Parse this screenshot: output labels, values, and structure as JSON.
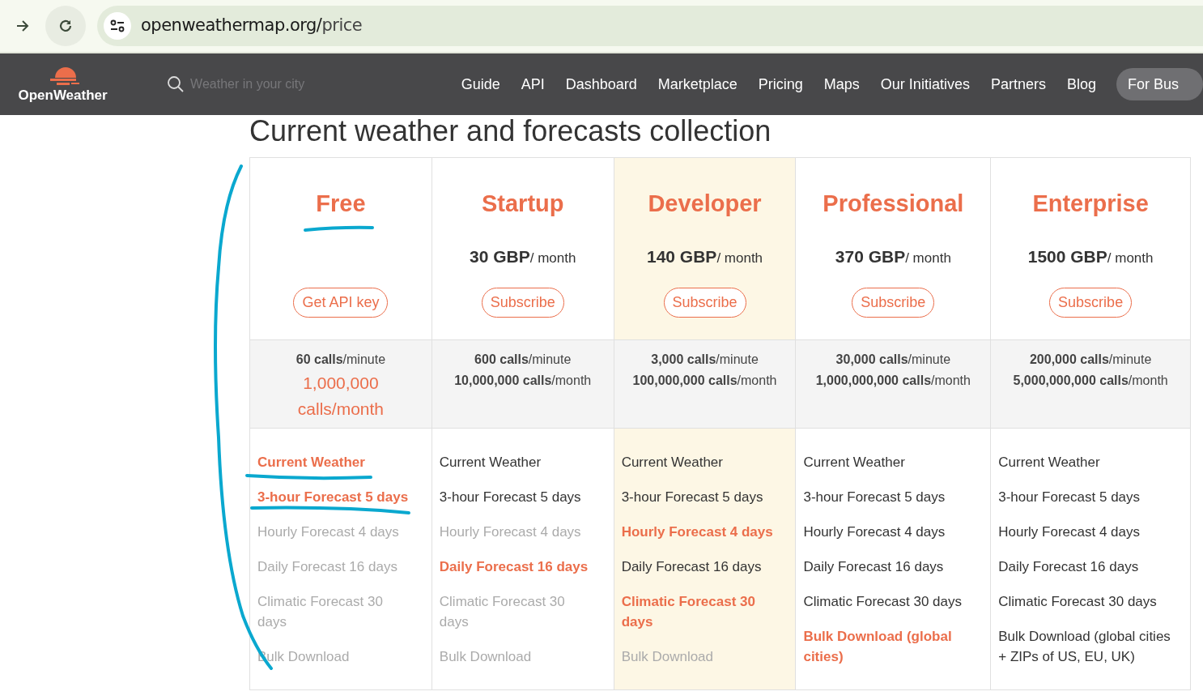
{
  "browser": {
    "url_host": "openweathermap.org/",
    "url_path": "price"
  },
  "site": {
    "logo": "OpenWeather",
    "search": {
      "placeholder": "Weather in your city"
    },
    "nav": [
      "Guide",
      "API",
      "Dashboard",
      "Marketplace",
      "Pricing",
      "Maps",
      "Our Initiatives",
      "Partners",
      "Blog"
    ],
    "cta": "For Bus"
  },
  "heading": "Current weather and forecasts collection",
  "plans": [
    {
      "name": "Free",
      "featured": false,
      "button": "Get API key",
      "calls_minute": "**60 calls**/minute",
      "calls_month": "1,000,000 calls/month",
      "month_emphasis": true,
      "features": [
        {
          "text": "Current Weather",
          "kind": "highlight"
        },
        {
          "text": "3-hour Forecast 5 days",
          "kind": "highlight"
        },
        {
          "text": "Hourly Forecast 4 days",
          "kind": "excluded"
        },
        {
          "text": "Daily Forecast 16 days",
          "kind": "excluded"
        },
        {
          "text": "Climatic Forecast 30 days",
          "kind": "excluded"
        },
        {
          "text": "Bulk Download",
          "kind": "excluded"
        }
      ]
    },
    {
      "name": "Startup",
      "featured": false,
      "price": "30 GBP",
      "unit": "/ month",
      "button": "Subscribe",
      "calls_minute": "**600 calls**/minute",
      "calls_month": "**10,000,000 calls**/month",
      "month_emphasis": false,
      "features": [
        {
          "text": "Current Weather",
          "kind": "included"
        },
        {
          "text": "3-hour Forecast 5 days",
          "kind": "included"
        },
        {
          "text": "Hourly Forecast 4 days",
          "kind": "excluded"
        },
        {
          "text": "Daily Forecast 16 days",
          "kind": "highlight"
        },
        {
          "text": "Climatic Forecast 30 days",
          "kind": "excluded"
        },
        {
          "text": "Bulk Download",
          "kind": "excluded"
        }
      ]
    },
    {
      "name": "Developer",
      "featured": true,
      "price": "140 GBP",
      "unit": "/ month",
      "button": "Subscribe",
      "calls_minute": "**3,000 calls**/minute",
      "calls_month": "**100,000,000 calls**/month",
      "month_emphasis": false,
      "features": [
        {
          "text": "Current Weather",
          "kind": "included"
        },
        {
          "text": "3-hour Forecast 5 days",
          "kind": "included"
        },
        {
          "text": "Hourly Forecast 4 days",
          "kind": "highlight"
        },
        {
          "text": "Daily Forecast 16 days",
          "kind": "included"
        },
        {
          "text": "Climatic Forecast 30 days",
          "kind": "highlight"
        },
        {
          "text": "Bulk Download",
          "kind": "excluded"
        }
      ]
    },
    {
      "name": "Professional",
      "featured": false,
      "price": "370 GBP",
      "unit": "/ month",
      "button": "Subscribe",
      "calls_minute": "**30,000 calls**/minute",
      "calls_month": "**1,000,000,000 calls**/month",
      "month_emphasis": false,
      "features": [
        {
          "text": "Current Weather",
          "kind": "included"
        },
        {
          "text": "3-hour Forecast 5 days",
          "kind": "included"
        },
        {
          "text": "Hourly Forecast 4 days",
          "kind": "included"
        },
        {
          "text": "Daily Forecast 16 days",
          "kind": "included"
        },
        {
          "text": "Climatic Forecast 30 days",
          "kind": "included"
        },
        {
          "text": "Bulk Download (global cities)",
          "kind": "highlight"
        }
      ]
    },
    {
      "name": "Enterprise",
      "featured": false,
      "price": "1500 GBP",
      "unit": "/ month",
      "button": "Subscribe",
      "calls_minute": "**200,000 calls**/minute",
      "calls_month": "**5,000,000,000 calls**/month",
      "month_emphasis": false,
      "features": [
        {
          "text": "Current Weather",
          "kind": "included"
        },
        {
          "text": "3-hour Forecast 5 days",
          "kind": "included"
        },
        {
          "text": "Hourly Forecast 4 days",
          "kind": "included"
        },
        {
          "text": "Daily Forecast 16 days",
          "kind": "included"
        },
        {
          "text": "Climatic Forecast 30 days",
          "kind": "included"
        },
        {
          "text": "Bulk Download (global cities + ZIPs of US, EU, UK)",
          "kind": "included"
        }
      ]
    }
  ]
}
